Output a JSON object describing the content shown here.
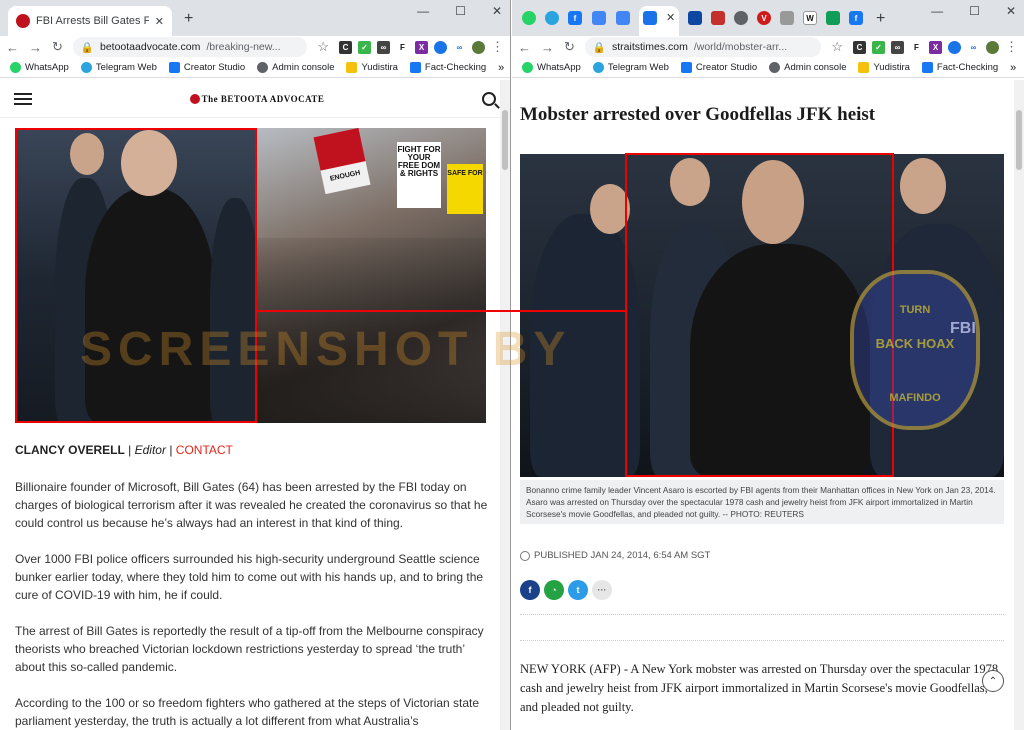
{
  "left_window": {
    "tab_title": "FBI Arrests Bill Gates For Biologic",
    "url_domain": "betootaadvocate.com",
    "url_path": "/breaking-new...",
    "site_logo": "The BETOOTA ADVOCATE",
    "byline": {
      "author": "CLANCY OVERELL",
      "role": "Editor",
      "contact": "CONTACT",
      "separator": "|"
    },
    "paragraphs": [
      "Billionaire founder of Microsoft, Bill Gates (64) has been arrested by the FBI today on charges of biological terrorism after it was revealed he created the coronavirus so that he could control us because he’s always had an interest in that kind of thing.",
      "Over 1000 FBI police officers surrounded his high-security underground Seattle science bunker earlier today, where they told him to come out with his hands up, and to bring the cure of COVID-19 with him, he if could.",
      "The arrest of Bill Gates is reportedly the result of a tip-off from the Melbourne conspiracy theorists who breached Victorian lockdown restrictions yesterday to spread ‘the truth’ about this so-called pandemic.",
      "According to the 100 or so freedom fighters who gathered at the steps of Victorian state parliament yesterday, the truth is actually a lot different from what Australia’s"
    ],
    "protest_signs": [
      "ENOUGH",
      "FIGHT FOR YOUR FREE DOM & RIGHTS",
      "SAFE FOR"
    ]
  },
  "right_window": {
    "url_domain": "straitstimes.com",
    "url_path": "/world/mobster-arr...",
    "headline": "Mobster arrested over Goodfellas JFK heist",
    "photo_badge": "FBI",
    "caption": "Bonanno crime family leader Vincent Asaro is escorted by FBI agents from their Manhattan offices in New York on Jan 23, 2014. Asaro was arrested on Thursday over the spectacular 1978 cash and jewelry heist from JFK airport immortalized in Martin Scorsese's movie Goodfellas, and pleaded not guilty. -- PHOTO: REUTERS",
    "published": "PUBLISHED  JAN 24, 2014, 6:54 AM SGT",
    "body": "NEW YORK (AFP) - A New York mobster was arrested on Thursday over the spectacular 1978 cash and jewelry heist from JFK airport immortalized in Martin Scorsese's movie Goodfellas, and pleaded not guilty."
  },
  "bookmarks": [
    "WhatsApp",
    "Telegram Web",
    "Creator Studio",
    "Admin console",
    "Yudistira",
    "Fact-Checking"
  ],
  "watermark": "SCREENSHOT BY",
  "seal_text": {
    "top": "TURN",
    "mid": "BACK HOAX",
    "bottom": "MAFINDO"
  },
  "colors": {
    "tab_strip": "#dee1e6",
    "red_marker": "#e00000",
    "contact_red": "#e1251b"
  }
}
